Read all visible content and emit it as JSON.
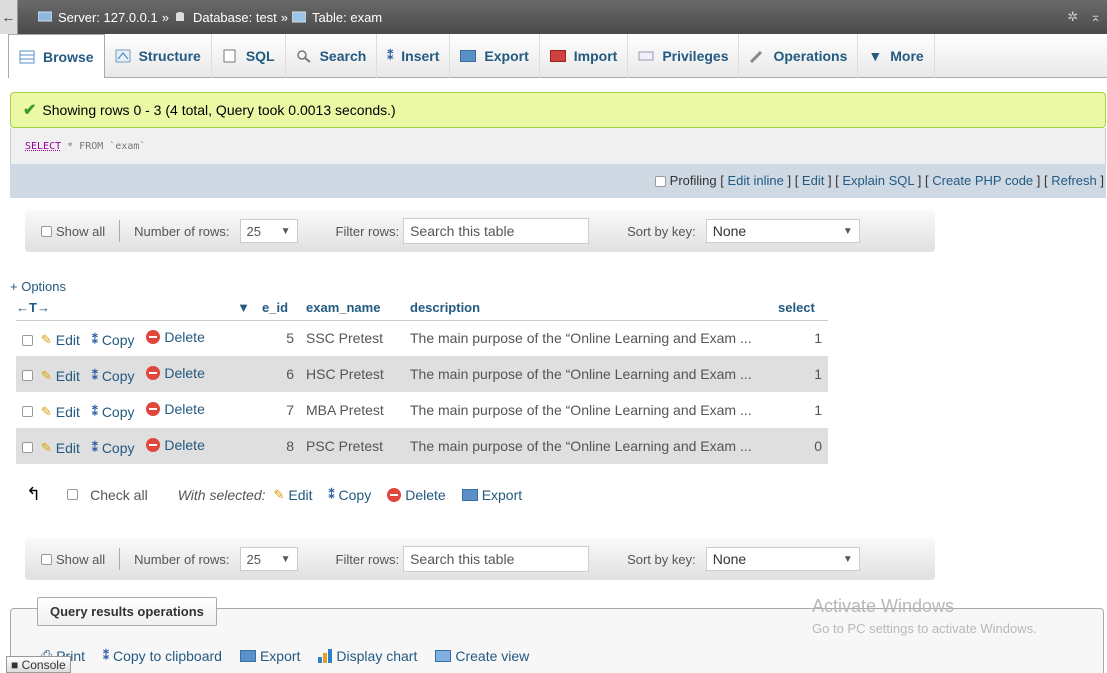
{
  "breadcrumb": {
    "server": "Server: 127.0.0.1",
    "database": "Database: test",
    "table": "Table: exam",
    "separator": "»"
  },
  "tabs": [
    "Browse",
    "Structure",
    "SQL",
    "Search",
    "Insert",
    "Export",
    "Import",
    "Privileges",
    "Operations",
    "More"
  ],
  "success_message": "Showing rows 0 - 3 (4 total, Query took 0.0013 seconds.)",
  "sql": {
    "keyword": "SELECT",
    "rest": " * FROM `exam`"
  },
  "links": {
    "profiling": "Profiling",
    "edit_inline": "Edit inline",
    "edit": "Edit",
    "explain": "Explain SQL",
    "create_php": "Create PHP code",
    "refresh": "Refresh"
  },
  "nav": {
    "show_all": "Show all",
    "number_of_rows_label": "Number of rows:",
    "rows_value": "25",
    "filter_label": "Filter rows:",
    "filter_placeholder": "Search this table",
    "sort_label": "Sort by key:",
    "sort_value": "None"
  },
  "options_label": "+ Options",
  "arrows_label": "←T→",
  "columns": [
    "e_id",
    "exam_name",
    "description",
    "select"
  ],
  "actions": {
    "edit": "Edit",
    "copy": "Copy",
    "delete": "Delete"
  },
  "rows": [
    {
      "e_id": "5",
      "exam_name": "SSC Pretest",
      "description": "The main purpose of the “Online Learning and Exam ...",
      "select": "1"
    },
    {
      "e_id": "6",
      "exam_name": "HSC Pretest",
      "description": "The main purpose of the “Online Learning and Exam ...",
      "select": "1"
    },
    {
      "e_id": "7",
      "exam_name": "MBA Pretest",
      "description": "The main purpose of the “Online Learning and Exam ...",
      "select": "1"
    },
    {
      "e_id": "8",
      "exam_name": "PSC Pretest",
      "description": "The main purpose of the “Online Learning and Exam ...",
      "select": "0"
    }
  ],
  "with_selected": {
    "check_all": "Check all",
    "label": "With selected:",
    "edit": "Edit",
    "copy": "Copy",
    "delete": "Delete",
    "export": "Export"
  },
  "query_ops": {
    "title": "Query results operations",
    "print": "Print",
    "copy_clipboard": "Copy to clipboard",
    "export": "Export",
    "display_chart": "Display chart",
    "create_view": "Create view"
  },
  "console": "Console",
  "activate": {
    "line1": "Activate Windows",
    "line2": "Go to PC settings to activate Windows."
  },
  "colors": {
    "link": "#235a81",
    "success_bg": "#ebf8a4",
    "row_alt": "#dfdfdf"
  }
}
